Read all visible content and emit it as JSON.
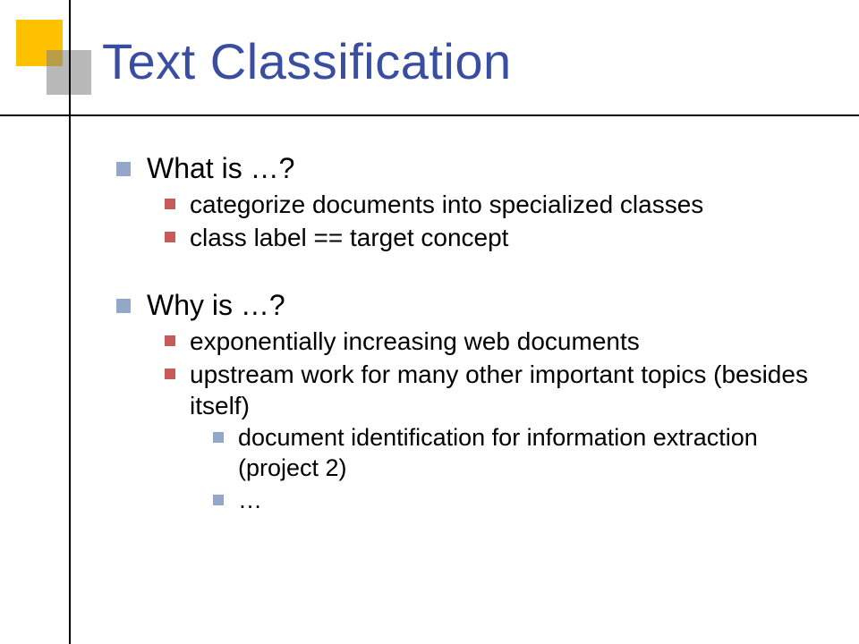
{
  "title": "Text Classification",
  "section1": {
    "heading": "What is …?",
    "items": [
      "categorize documents into specialized classes",
      "class label == target concept"
    ]
  },
  "section2": {
    "heading": "Why is …?",
    "items": [
      "exponentially increasing web documents",
      "upstream work for many other important topics (besides itself)"
    ],
    "subitems": [
      "document identification for information extraction (project 2)",
      "…"
    ]
  }
}
